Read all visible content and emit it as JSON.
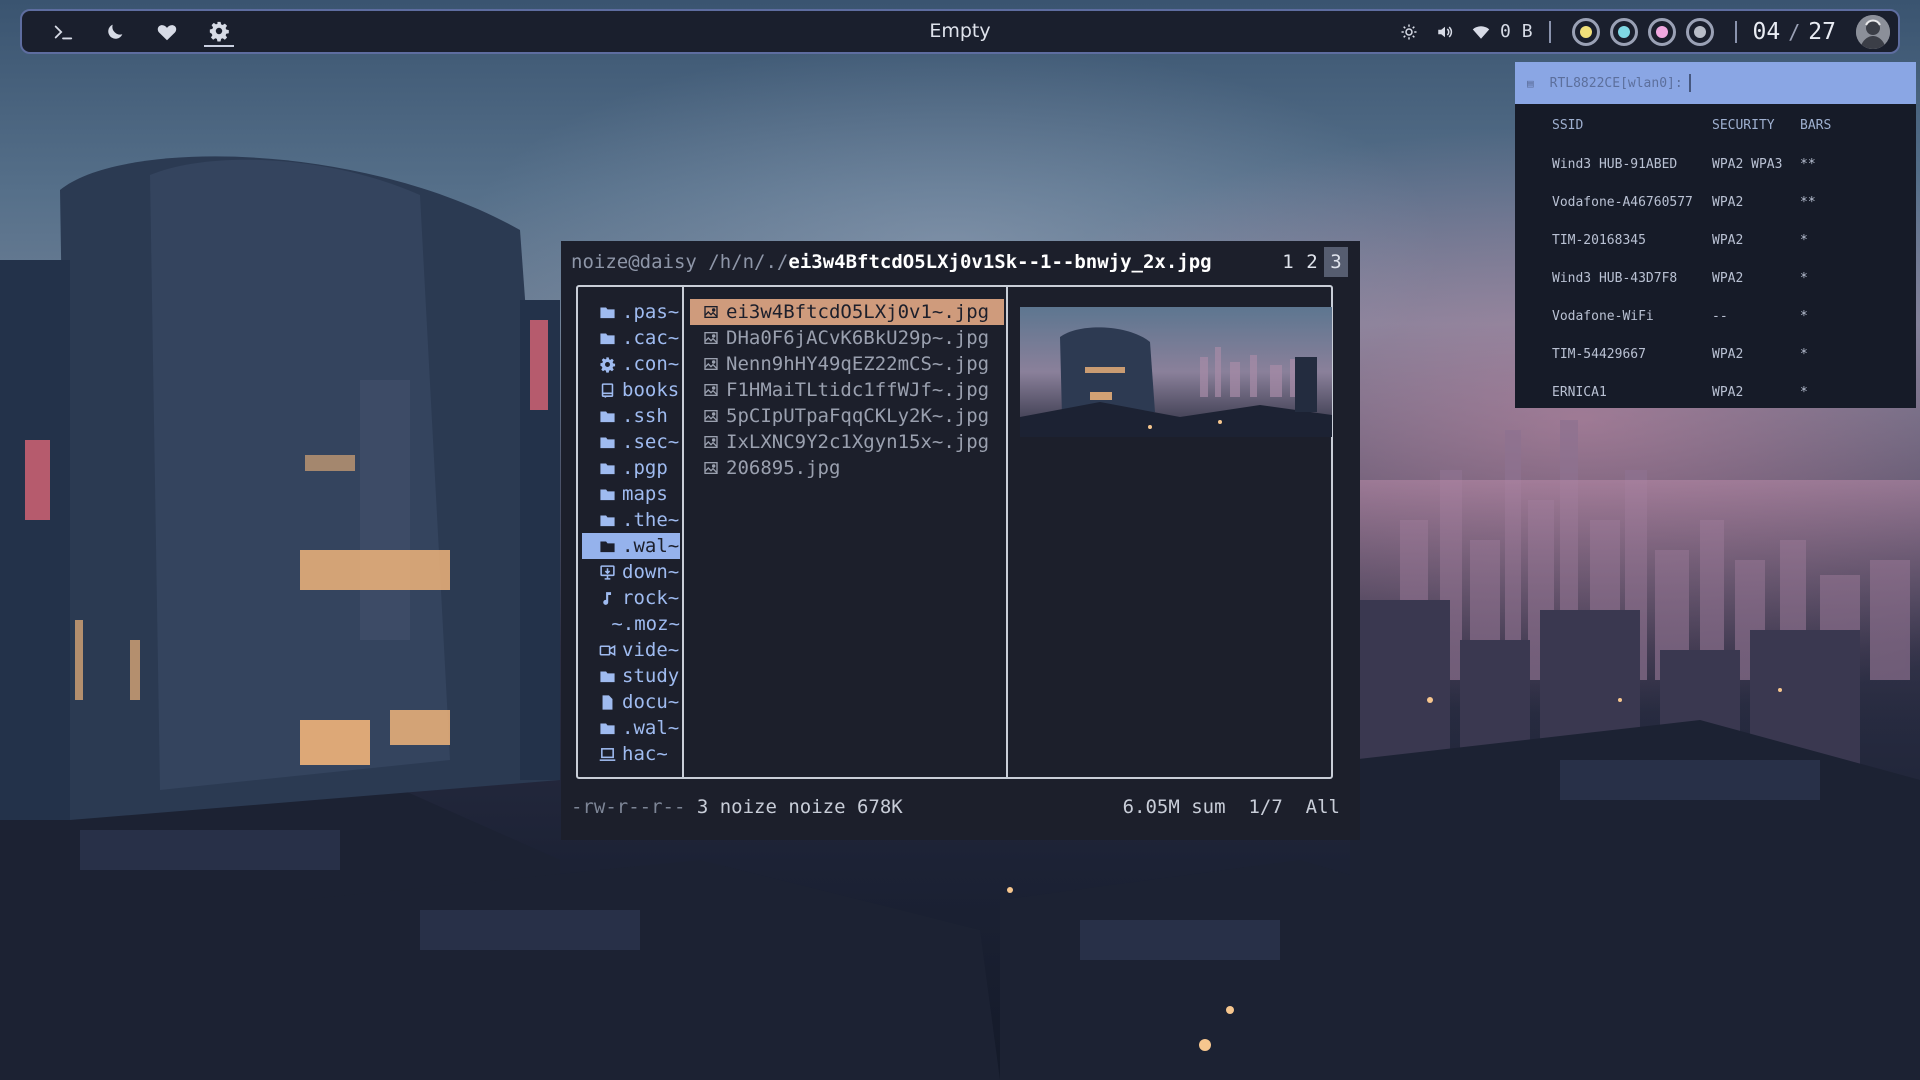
{
  "topbar": {
    "left_icons": [
      "terminal-icon",
      "moon-icon",
      "heart-icon",
      "gear-icon"
    ],
    "title": "Empty",
    "network_speed": "0 B",
    "clock_hour": "04",
    "clock_sep": "/",
    "clock_day": "27",
    "workspaces": [
      {
        "name": "workspace-1",
        "color": "#f1e07a"
      },
      {
        "name": "workspace-2",
        "color": "#7fd8e4"
      },
      {
        "name": "workspace-3",
        "color": "#f0a8e0"
      },
      {
        "name": "workspace-4",
        "color": "#b8bdc8"
      }
    ]
  },
  "wifi": {
    "prompt": "RTL8822CE[wlan0]:",
    "headers": {
      "ssid": "SSID",
      "security": "SECURITY",
      "bars": "BARS"
    },
    "networks": [
      {
        "ssid": "Wind3 HUB-91ABED",
        "security": "WPA2 WPA3",
        "bars": "**"
      },
      {
        "ssid": "Vodafone-A46760577",
        "security": "WPA2",
        "bars": "**"
      },
      {
        "ssid": "TIM-20168345",
        "security": "WPA2",
        "bars": "*"
      },
      {
        "ssid": "Wind3 HUB-43D7F8",
        "security": "WPA2",
        "bars": "*"
      },
      {
        "ssid": "Vodafone-WiFi",
        "security": "--",
        "bars": "*"
      },
      {
        "ssid": "TIM-54429667",
        "security": "WPA2",
        "bars": "*"
      },
      {
        "ssid": "ERNICA1",
        "security": "WPA2",
        "bars": "*"
      }
    ]
  },
  "fm": {
    "user": "noize@daisy",
    "path": "/h/n/./",
    "file": "ei3w4BftcdO5LXj0v1Sk--1--bnwjy_2x.jpg",
    "tabs": [
      "1",
      "2",
      "3"
    ],
    "active_tab": "3",
    "dirs": [
      {
        "label": ".pas~",
        "icon": "folder-icon"
      },
      {
        "label": ".cac~",
        "icon": "folder-icon"
      },
      {
        "label": ".con~",
        "icon": "gear-icon"
      },
      {
        "label": "books",
        "icon": "book-icon"
      },
      {
        "label": ".ssh",
        "icon": "folder-icon"
      },
      {
        "label": ".sec~",
        "icon": "folder-icon"
      },
      {
        "label": ".pgp",
        "icon": "folder-icon"
      },
      {
        "label": "maps",
        "icon": "folder-icon"
      },
      {
        "label": ".the~",
        "icon": "folder-icon"
      },
      {
        "label": ".wal~",
        "icon": "folder-icon"
      },
      {
        "label": "down~",
        "icon": "download-icon"
      },
      {
        "label": "rock~",
        "icon": "music-icon"
      },
      {
        "label": "~.moz~",
        "icon": ""
      },
      {
        "label": "vide~",
        "icon": "video-icon"
      },
      {
        "label": "study",
        "icon": "folder-icon"
      },
      {
        "label": "docu~",
        "icon": "document-icon"
      },
      {
        "label": ".wal~",
        "icon": "folder-icon"
      },
      {
        "label": "hac~",
        "icon": "laptop-icon"
      }
    ],
    "selected_dir": 9,
    "files": [
      "ei3w4BftcdO5LXj0v1~.jpg",
      "DHa0F6jACvK6BkU29p~.jpg",
      "Nenn9hHY49qEZ22mCS~.jpg",
      "F1HMaiTLtidc1ffWJf~.jpg",
      "5pCIpUTpaFqqCKLy2K~.jpg",
      "IxLXNC9Y2c1Xgyn15x~.jpg",
      "206895.jpg"
    ],
    "selected_file": 0,
    "status": {
      "perms": "-rw-r--r--",
      "info": "3 noize noize 678K",
      "sum": "6.05M sum",
      "pos": "1/7",
      "scroll": "All"
    }
  }
}
